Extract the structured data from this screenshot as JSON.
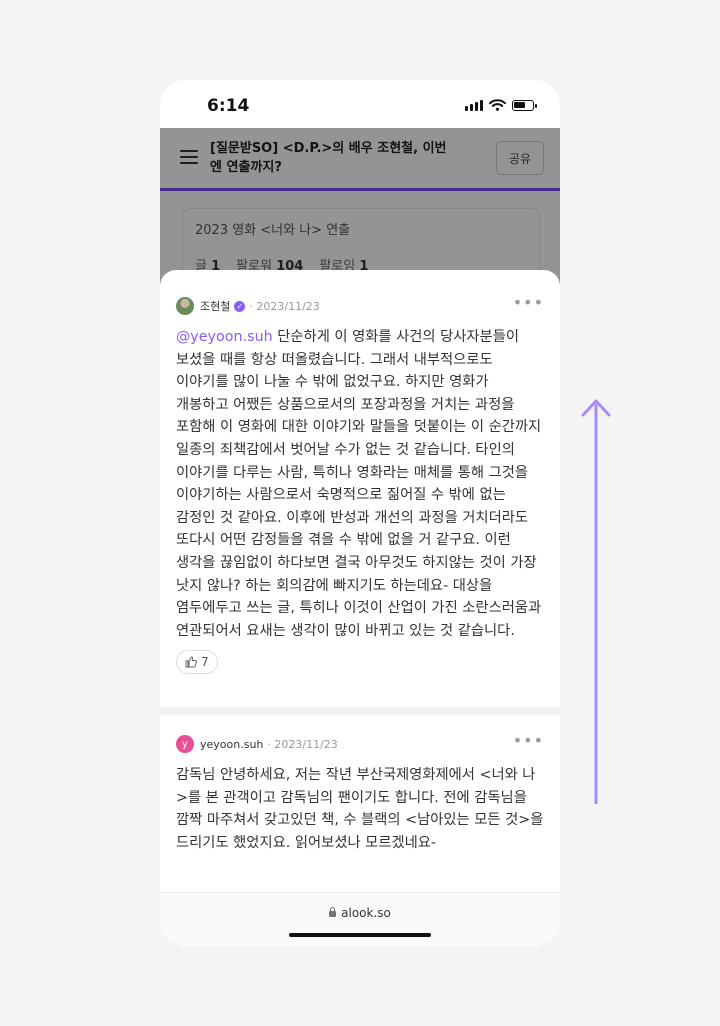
{
  "status_bar": {
    "time": "6:14"
  },
  "header": {
    "title": "[질문받SO] <D.P.>의 배우 조현철, 이번엔 연출까지?",
    "share_label": "공유"
  },
  "profile": {
    "description": "2023 영화 <너와 나> 연출",
    "stats": {
      "posts_label": "글",
      "posts_value": "1",
      "followers_label": "팔로워",
      "followers_value": "104",
      "following_label": "팔로잉",
      "following_value": "1"
    }
  },
  "comments": [
    {
      "author": "조현철",
      "avatar_initial": "",
      "verified": true,
      "date": "2023/11/23",
      "mention": "@yeyoon.suh",
      "body": " 단순하게 이 영화를 사건의 당사자분들이 보셨을 때를 항상 떠올렸습니다. 그래서 내부적으로도 이야기를 많이 나눌 수 밖에 없었구요. 하지만 영화가 개봉하고 어쨌든 상품으로서의 포장과정을 거치는 과정을 포함해 이 영화에 대한 이야기와 말들을 덧붙이는 이 순간까지 일종의 죄책감에서 벗어날 수가 없는 것 같습니다. 타인의 이야기를 다루는 사람, 특히나 영화라는 매체를 통해 그것을 이야기하는 사람으로서 숙명적으로 짊어질 수 밖에 없는 감정인 것 같아요. 이후에 반성과 개선의 과정을 거치더라도 또다시 어떤 감정들을 겪을 수 밖에 없을 거 같구요. 이런 생각을 끊임없이 하다보면 결국 아무것도 하지않는 것이 가장 낫지 않나? 하는 회의감에 빠지기도 하는데요- 대상을 염두에두고 쓰는 글, 특히나 이것이 산업이 가진 소란스러움과 연관되어서 요새는 생각이 많이 바뀌고 있는 것 같습니다.",
      "likes": "7"
    },
    {
      "author": "yeyoon.suh",
      "avatar_initial": "y",
      "verified": false,
      "date": "2023/11/23",
      "mention": "",
      "body": "감독님 안녕하세요, 저는 작년 부산국제영화제에서 <너와 나>를 본 관객이고 감독님의 팬이기도 합니다. 전에 감독님을 깜짝 마주쳐서 갖고있던 책, 수 블랙의 <남아있는 모든 것>을 드리기도 했었지요. 읽어보셨나 모르겠네요-"
    }
  ],
  "browser": {
    "url": "alook.so"
  },
  "colors": {
    "accent": "#8b5cf6",
    "arrow": "#a78bfa"
  },
  "icons": {
    "menu": "hamburger-icon",
    "more": "more-icon",
    "like": "thumbs-up-icon",
    "lock": "lock-icon",
    "gesture": "swipe-up-arrow-icon"
  }
}
